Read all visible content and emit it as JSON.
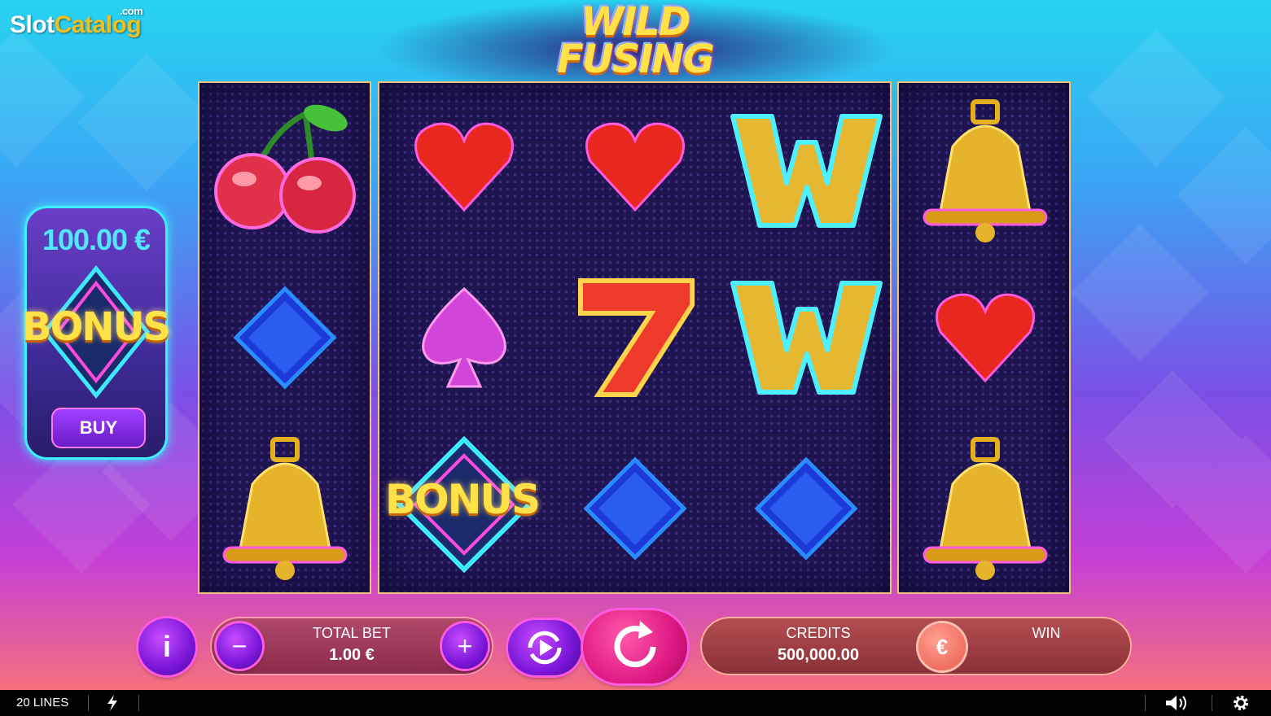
{
  "watermark": {
    "brand_a": "Slot",
    "brand_b": "Catalog",
    "suffix": ".com"
  },
  "logo": {
    "line1": "WILD",
    "line2": "FUSING"
  },
  "reels": [
    [
      "cherry",
      "blue-diamond",
      "gold-bell"
    ],
    [
      "red-heart",
      "purple-spade",
      "bonus"
    ],
    [
      "red-heart",
      "lucky-seven",
      "blue-diamond"
    ],
    [
      "wild-w",
      "wild-w",
      "blue-diamond"
    ],
    [
      "gold-bell",
      "red-heart",
      "gold-bell"
    ]
  ],
  "symbols": {
    "bonus_label": "BONUS",
    "wild_label": "W",
    "seven_label": "7"
  },
  "bonus_buy": {
    "price": "100.00 €",
    "label": "BONUS",
    "buy_label": "BUY"
  },
  "controls": {
    "info_label": "i",
    "minus_label": "−",
    "plus_label": "+",
    "total_bet_label": "TOTAL BET",
    "total_bet_value": "1.00 €",
    "credits_label": "CREDITS",
    "credits_value": "500,000.00",
    "currency_symbol": "€",
    "win_label": "WIN",
    "win_value": ""
  },
  "statusbar": {
    "lines_label": "20 LINES"
  },
  "colors": {
    "accent_cyan": "#3ef0ff",
    "accent_pink": "#ff5ae0",
    "gold": "#ffe14a"
  }
}
